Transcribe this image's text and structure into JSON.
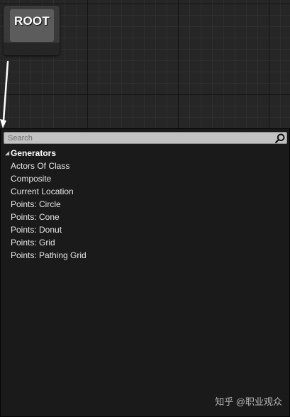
{
  "graph": {
    "root_node": {
      "title": "ROOT"
    }
  },
  "menu": {
    "search": {
      "placeholder": "Search",
      "value": ""
    },
    "category": {
      "label": "Generators",
      "items": [
        "Actors Of Class",
        "Composite",
        "Current Location",
        "Points: Circle",
        "Points: Cone",
        "Points: Donut",
        "Points: Grid",
        "Points: Pathing Grid"
      ]
    }
  },
  "watermark": {
    "text": "知乎 @职业观众"
  },
  "colors": {
    "graph_background": "#262626",
    "menu_background": "#1a1a1a",
    "search_background": "#c2c2c2",
    "node_body": "#3a3a3a",
    "node_header": "#5c5c5c",
    "wire": "#ffffff"
  },
  "icons": {
    "search": "search-icon",
    "expander": "triangle-down-icon",
    "wire_end": "arrowhead-icon"
  }
}
